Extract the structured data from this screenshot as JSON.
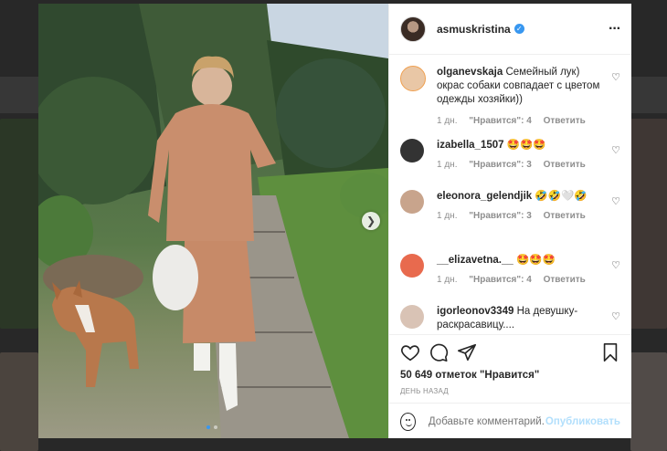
{
  "post": {
    "author": "asmuskristina",
    "verified_icon": "verified-badge-icon",
    "more_icon": "more-options-icon",
    "likes_text": "50 649 отметок \"Нравится\"",
    "date_text": "ДЕНЬ НАЗАД"
  },
  "comments": [
    {
      "user": "olganevskaja",
      "text": "Семейный лук) окрас собаки совпадает с цветом одежды хозяйки))",
      "age": "1 дн.",
      "likes": "\"Нравится\": 4",
      "reply": "Ответить",
      "avatar_color": "#e9c7a6"
    },
    {
      "user": "izabella_1507",
      "text": "🤩🤩🤩",
      "age": "1 дн.",
      "likes": "\"Нравится\": 3",
      "reply": "Ответить",
      "avatar_color": "#333333"
    },
    {
      "user": "eleonora_gelendjik",
      "text": "🤣🤣🤍🤣",
      "age": "1 дн.",
      "likes": "\"Нравится\": 3",
      "reply": "Ответить",
      "avatar_color": "#c8a48c"
    },
    {
      "user": "__elizavetna.__",
      "text": "🤩🤩🤩",
      "age": "1 дн.",
      "likes": "\"Нравится\": 4",
      "reply": "Ответить",
      "avatar_color": "#e86a4e"
    },
    {
      "user": "igorleonov3349",
      "text": "На девушку-раскрасавицу....",
      "age": "",
      "likes": "",
      "reply": "",
      "avatar_color": "#d9c3b5"
    }
  ],
  "add_comment": {
    "placeholder": "Добавьте комментарий...",
    "post_label": "Опубликовать"
  },
  "colors": {
    "accent": "#3897f0",
    "post_disabled": "#b2dffc",
    "dress": "#c98e6d"
  }
}
